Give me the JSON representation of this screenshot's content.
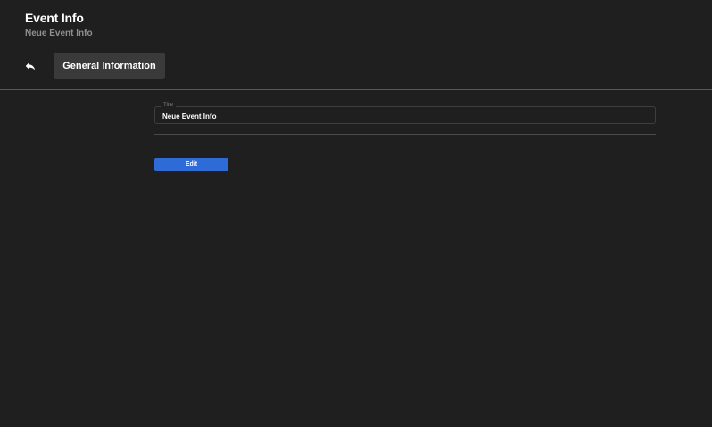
{
  "header": {
    "title": "Event Info",
    "subtitle": "Neue Event Info"
  },
  "nav": {
    "back_icon": "undo-arrow-icon",
    "tabs": [
      {
        "label": "General Information",
        "active": true
      }
    ]
  },
  "form": {
    "title_field": {
      "label": "Title",
      "value": "Neue Event Info"
    },
    "edit_label": "Edit"
  },
  "colors": {
    "background": "#1f1f1f",
    "tab_background": "#3a3a3a",
    "accent": "#2f6bd6",
    "subtitle_text": "#8f8f8f"
  }
}
